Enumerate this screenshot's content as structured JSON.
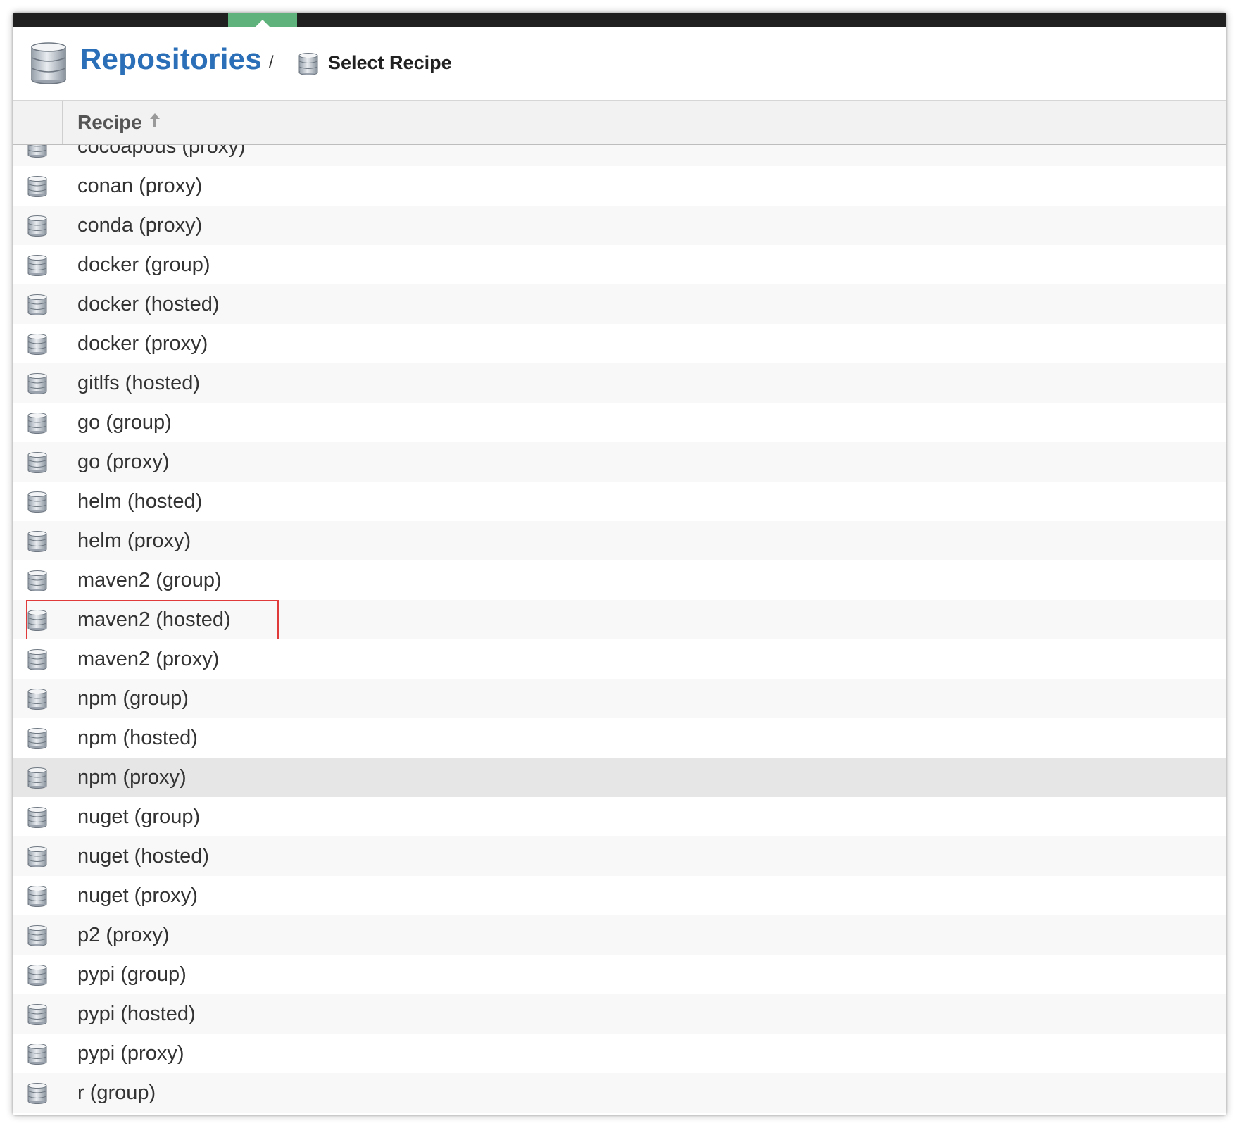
{
  "header": {
    "title": "Repositories",
    "separator": "/",
    "breadcrumb": "Select Recipe",
    "icon": "database-icon"
  },
  "table": {
    "column_header": "Recipe",
    "sort_icon": "sort-ascending-arrow-icon",
    "row_icon": "database-icon",
    "rows": [
      {
        "label": "cocoapods (proxy)"
      },
      {
        "label": "conan (proxy)"
      },
      {
        "label": "conda (proxy)"
      },
      {
        "label": "docker (group)"
      },
      {
        "label": "docker (hosted)"
      },
      {
        "label": "docker (proxy)"
      },
      {
        "label": "gitlfs (hosted)"
      },
      {
        "label": "go (group)"
      },
      {
        "label": "go (proxy)"
      },
      {
        "label": "helm (hosted)"
      },
      {
        "label": "helm (proxy)"
      },
      {
        "label": "maven2 (group)"
      },
      {
        "label": "maven2 (hosted)",
        "highlighted": true
      },
      {
        "label": "maven2 (proxy)"
      },
      {
        "label": "npm (group)"
      },
      {
        "label": "npm (hosted)"
      },
      {
        "label": "npm (proxy)",
        "hovered": true
      },
      {
        "label": "nuget (group)"
      },
      {
        "label": "nuget (hosted)"
      },
      {
        "label": "nuget (proxy)"
      },
      {
        "label": "p2 (proxy)"
      },
      {
        "label": "pypi (group)"
      },
      {
        "label": "pypi (hosted)"
      },
      {
        "label": "pypi (proxy)"
      },
      {
        "label": "r (group)"
      }
    ]
  },
  "colors": {
    "title": "#2a6fb7",
    "topbar": "#202020",
    "active_tab": "#5fb27b",
    "highlight_border": "#e03a3a"
  }
}
